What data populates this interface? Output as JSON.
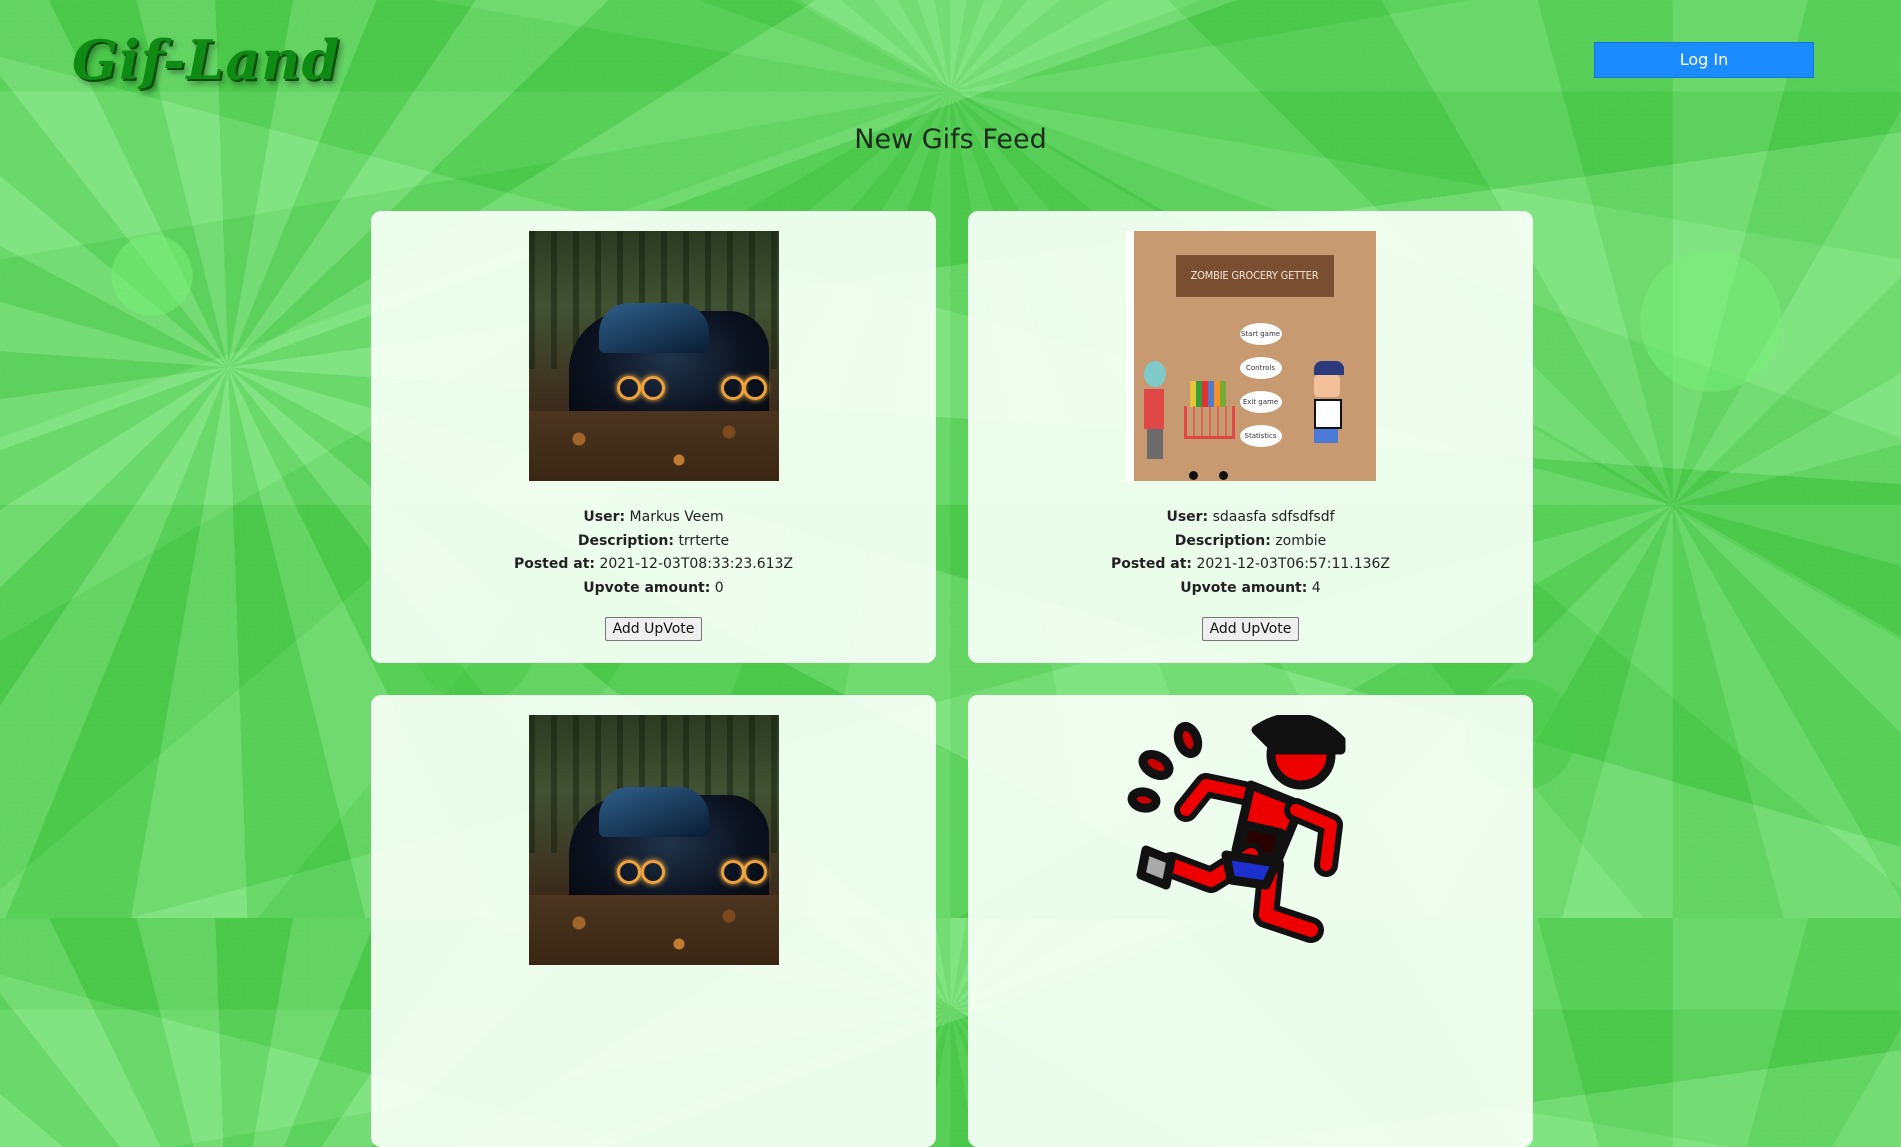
{
  "header": {
    "logo_text": "Gif-Land",
    "login_label": "Log In"
  },
  "page_title": "New Gifs Feed",
  "labels": {
    "user": "User:",
    "description": "Description:",
    "posted_at": "Posted at:",
    "upvote_amount": "Upvote amount:",
    "add_upvote": "Add UpVote"
  },
  "posts": [
    {
      "image": "black-car-photo",
      "user": "Markus Veem",
      "description": "trrterte",
      "posted_at": "2021-12-03T08:33:23.613Z",
      "upvotes": "0"
    },
    {
      "image": "zombie-grocery-getter-game",
      "image_title": "ZOMBIE GROCERY GETTER",
      "menu_items": [
        "Start game",
        "Controls",
        "Exit game",
        "Statistics"
      ],
      "user": "sdaasfa sdfsdfsdf",
      "description": "zombie",
      "posted_at": "2021-12-03T06:57:11.136Z",
      "upvotes": "4"
    },
    {
      "image": "black-car-photo"
    },
    {
      "image": "running-cartoon-man"
    }
  ],
  "colors": {
    "background": "#5ddb5d",
    "login_button": "#1a8cff",
    "logo": "#0f8a14",
    "card": "#f5fff5"
  }
}
